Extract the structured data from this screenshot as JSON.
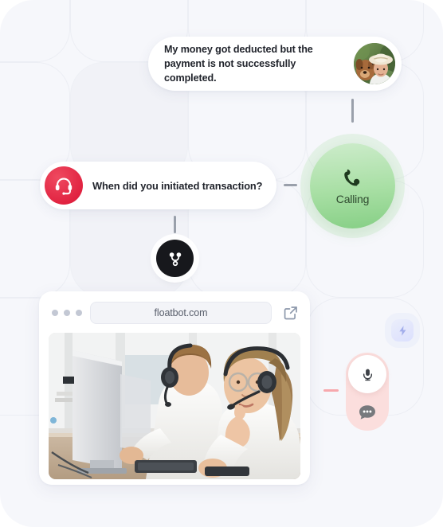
{
  "canvas": {
    "background_color": "#f6f7fb",
    "corner_radius_px": 42
  },
  "user_message": {
    "text": "My money got deducted but the payment is not successfully completed.",
    "avatar_name": "user-avatar-photo"
  },
  "bot_message": {
    "text": "When did you initiated transaction?",
    "avatar_icon": "headset-icon",
    "avatar_color": "#e0213f"
  },
  "calling_node": {
    "label": "Calling",
    "icon": "phone-handset-icon",
    "color": "#a8dfa4"
  },
  "flow_node": {
    "icon": "flow-merge-icon",
    "color": "#17181c"
  },
  "browser": {
    "url": "floatbot.com",
    "traffic_lights": [
      "dot-1",
      "dot-2",
      "dot-3"
    ],
    "open_external_icon": "external-link-icon",
    "photo_alt": "call-center-agents-photo"
  },
  "voice_widget": {
    "mic_icon": "microphone-icon",
    "chat_icon": "chat-bubble-icon",
    "background_color": "#fbdedd"
  },
  "lightning_badge": {
    "icon": "lightning-bolt-icon",
    "color": "#d9deff"
  },
  "connectors": [
    {
      "name": "connector-user-to-calling",
      "orientation": "vertical",
      "color": "#9aa0ab"
    },
    {
      "name": "connector-bot-to-calling",
      "orientation": "horizontal",
      "color": "#9aa0ab"
    },
    {
      "name": "connector-bot-to-flow",
      "orientation": "vertical",
      "color": "#9aa0ab"
    },
    {
      "name": "connector-widget",
      "orientation": "horizontal",
      "color": "#f7a8ad"
    }
  ]
}
